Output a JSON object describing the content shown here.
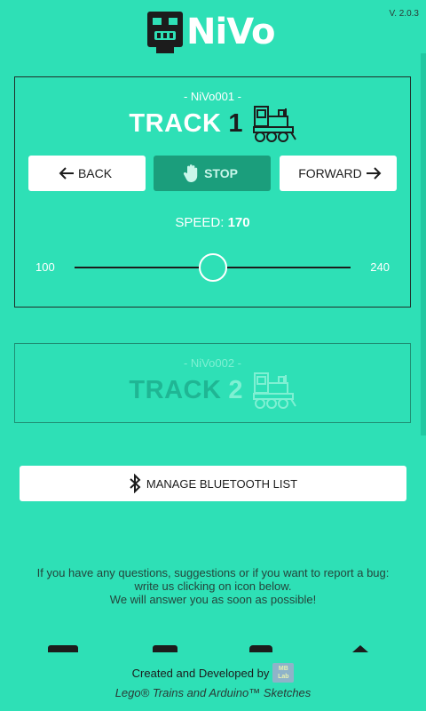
{
  "app": {
    "name": "NiVo",
    "version": "V. 2.0.3"
  },
  "tracks": [
    {
      "device": "- NiVo001 -",
      "title": "TRACK",
      "number": "1",
      "back_label": "BACK",
      "stop_label": "STOP",
      "forward_label": "FORWARD",
      "speed_label": "SPEED:",
      "speed_value": "170",
      "slider_min": "100",
      "slider_max": "240",
      "slider_value": 170,
      "active": true
    },
    {
      "device": "- NiVo002 -",
      "title": "TRACK",
      "number": "2",
      "active": false
    }
  ],
  "bluetooth": {
    "label": "MANAGE BLUETOOTH LIST",
    "icon": "bluetooth-icon"
  },
  "info": {
    "line1": "If you have any questions, suggestions or if you want to report a bug:",
    "line2": "write us clicking on icon below.",
    "line3": "We will answer you as soon as possible!"
  },
  "footer": {
    "created": "Created and Developed by",
    "badge_top": "MB",
    "badge_bottom": "Lab",
    "subtitle": "Lego® Trains and Arduino™ Sketches"
  },
  "colors": {
    "background": "#2ee0b6",
    "stop_button": "#1b9e7c",
    "text_dark": "#1c1c1c"
  }
}
